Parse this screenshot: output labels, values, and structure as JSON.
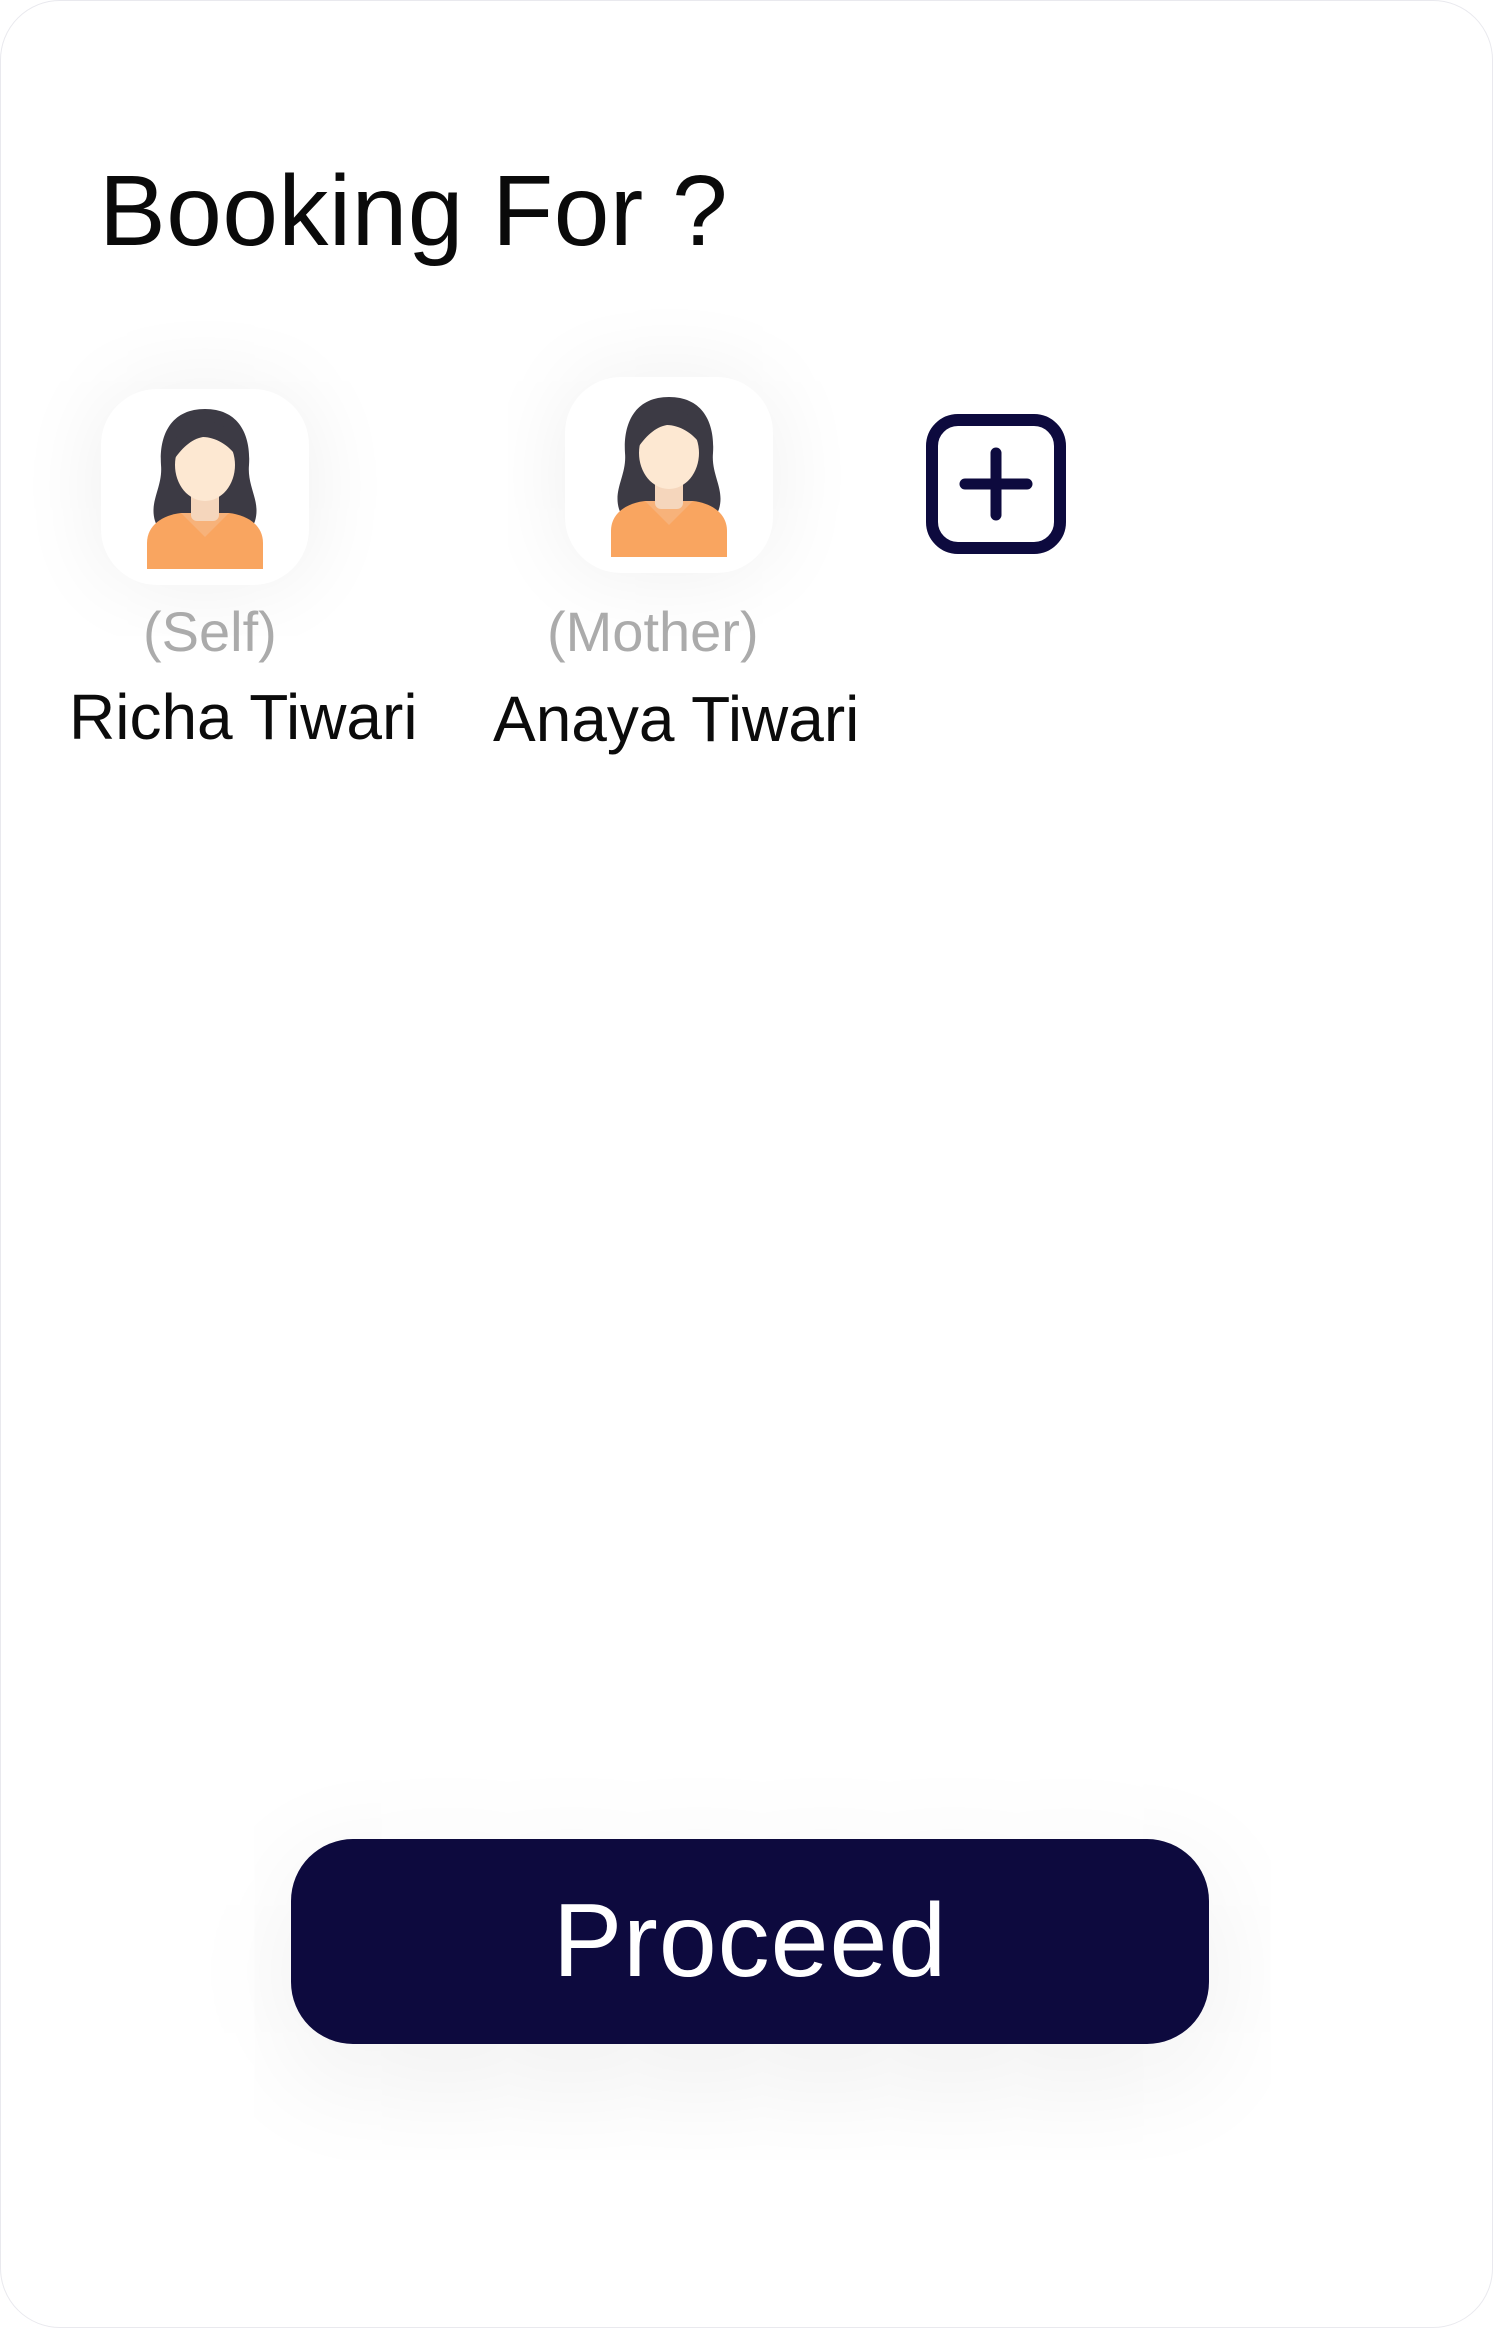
{
  "header": {
    "title": "Booking For ?"
  },
  "members": [
    {
      "relation": "(Self)",
      "name": "Richa Tiwari",
      "avatar_icon": "woman-avatar-icon"
    },
    {
      "relation": "(Mother)",
      "name": "Anaya Tiwari",
      "avatar_icon": "woman-avatar-icon"
    }
  ],
  "add_member": {
    "icon": "plus-square-icon"
  },
  "footer": {
    "proceed_label": "Proceed"
  },
  "colors": {
    "primary": "#0d0a3e",
    "relation_text": "#ababab",
    "name_text": "#0b0b0b",
    "avatar_hair": "#3c3a44",
    "avatar_skin": "#fde8d2",
    "avatar_shirt": "#f9a560"
  }
}
